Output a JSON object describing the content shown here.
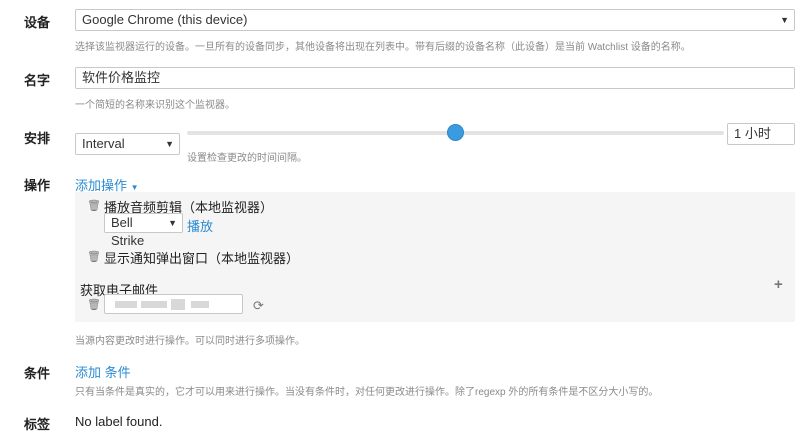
{
  "device": {
    "label": "设备",
    "value": "Google Chrome (this device)",
    "help": "选择该监视器运行的设备。一旦所有的设备同步，其他设备将出现在列表中。带有后缀的设备名称（此设备）是当前 Watchlist 设备的名称。"
  },
  "name": {
    "label": "名字",
    "value": "软件价格监控",
    "help": "一个简短的名称来识别这个监视器。"
  },
  "schedule": {
    "label": "安排",
    "mode": "Interval",
    "interval_text": "1 小时",
    "slider_fraction": 0.5,
    "help": "设置检查更改的时间间隔。"
  },
  "actions": {
    "label": "操作",
    "add_link": "添加操作",
    "items": [
      {
        "title": "播放音频剪辑（本地监视器）",
        "sound": "Bell Strike",
        "play_link": "播放"
      },
      {
        "title": "显示通知弹出窗口（本地监视器）"
      },
      {
        "title": "获取电子邮件"
      }
    ],
    "help": "当源内容更改时进行操作。可以同时进行多项操作。"
  },
  "conditions": {
    "label": "条件",
    "add_prefix": "添加",
    "add_link": "条件",
    "help": "只有当条件是真实的，它才可以用来进行操作。当没有条件时，对任何更改进行操作。除了regexp 外的所有条件是不区分大小写的。"
  },
  "labels": {
    "label": "标签",
    "value": "No label found."
  },
  "icons": {
    "trash": "trash-icon",
    "refresh": "refresh-icon",
    "plus": "plus-icon",
    "caret": "caret-down-icon"
  }
}
